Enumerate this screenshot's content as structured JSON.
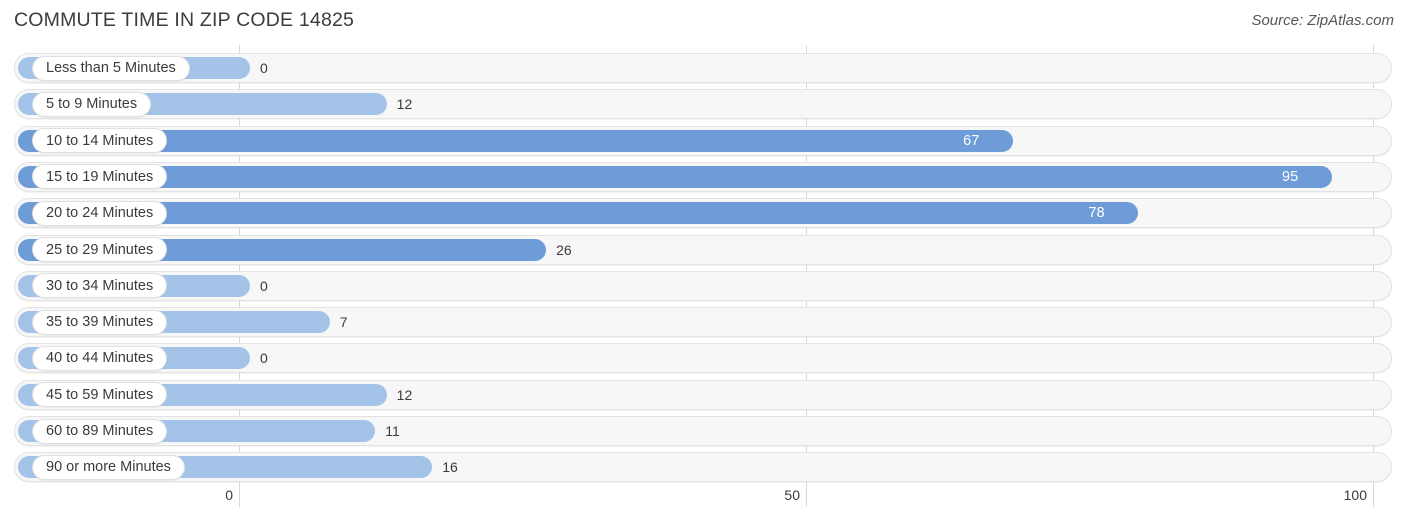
{
  "header": {
    "title": "COMMUTE TIME IN ZIP CODE 14825",
    "source": "Source: ZipAtlas.com"
  },
  "colors": {
    "bar_light": "#a3c4e8",
    "bar_dark": "#6d9cd8",
    "track_bg": "#f7f7f7",
    "track_border": "#e3e3e3",
    "gridline": "#d8d8d8",
    "text": "#3b3b3b",
    "value_inside": "#ffffff"
  },
  "chart_data": {
    "type": "bar",
    "orientation": "horizontal",
    "title": "COMMUTE TIME IN ZIP CODE 14825",
    "xlabel": "",
    "ylabel": "",
    "xlim": [
      0,
      100
    ],
    "grid": true,
    "legend": null,
    "axis_ticks": [
      {
        "label": "0",
        "value": 0
      },
      {
        "label": "50",
        "value": 50
      },
      {
        "label": "100",
        "value": 100
      }
    ],
    "categories": [
      "Less than 5 Minutes",
      "5 to 9 Minutes",
      "10 to 14 Minutes",
      "15 to 19 Minutes",
      "20 to 24 Minutes",
      "25 to 29 Minutes",
      "30 to 34 Minutes",
      "35 to 39 Minutes",
      "40 to 44 Minutes",
      "45 to 59 Minutes",
      "60 to 89 Minutes",
      "90 or more Minutes"
    ],
    "values": [
      0,
      12,
      67,
      95,
      78,
      26,
      0,
      7,
      0,
      12,
      11,
      16
    ],
    "value_labels": [
      "0",
      "12",
      "67",
      "95",
      "78",
      "26",
      "0",
      "7",
      "0",
      "12",
      "11",
      "16"
    ]
  },
  "rows": [
    {
      "label": "Less than 5 Minutes",
      "value": 0,
      "value_label": "0",
      "shade": "light",
      "label_inside": false
    },
    {
      "label": "5 to 9 Minutes",
      "value": 12,
      "value_label": "12",
      "shade": "light",
      "label_inside": false
    },
    {
      "label": "10 to 14 Minutes",
      "value": 67,
      "value_label": "67",
      "shade": "dark",
      "label_inside": true
    },
    {
      "label": "15 to 19 Minutes",
      "value": 95,
      "value_label": "95",
      "shade": "dark",
      "label_inside": true
    },
    {
      "label": "20 to 24 Minutes",
      "value": 78,
      "value_label": "78",
      "shade": "dark",
      "label_inside": true
    },
    {
      "label": "25 to 29 Minutes",
      "value": 26,
      "value_label": "26",
      "shade": "dark",
      "label_inside": false
    },
    {
      "label": "30 to 34 Minutes",
      "value": 0,
      "value_label": "0",
      "shade": "light",
      "label_inside": false
    },
    {
      "label": "35 to 39 Minutes",
      "value": 7,
      "value_label": "7",
      "shade": "light",
      "label_inside": false
    },
    {
      "label": "40 to 44 Minutes",
      "value": 0,
      "value_label": "0",
      "shade": "light",
      "label_inside": false
    },
    {
      "label": "45 to 59 Minutes",
      "value": 12,
      "value_label": "12",
      "shade": "light",
      "label_inside": false
    },
    {
      "label": "60 to 89 Minutes",
      "value": 11,
      "value_label": "11",
      "shade": "light",
      "label_inside": false
    },
    {
      "label": "90 or more Minutes",
      "value": 16,
      "value_label": "16",
      "shade": "light",
      "label_inside": false
    }
  ]
}
